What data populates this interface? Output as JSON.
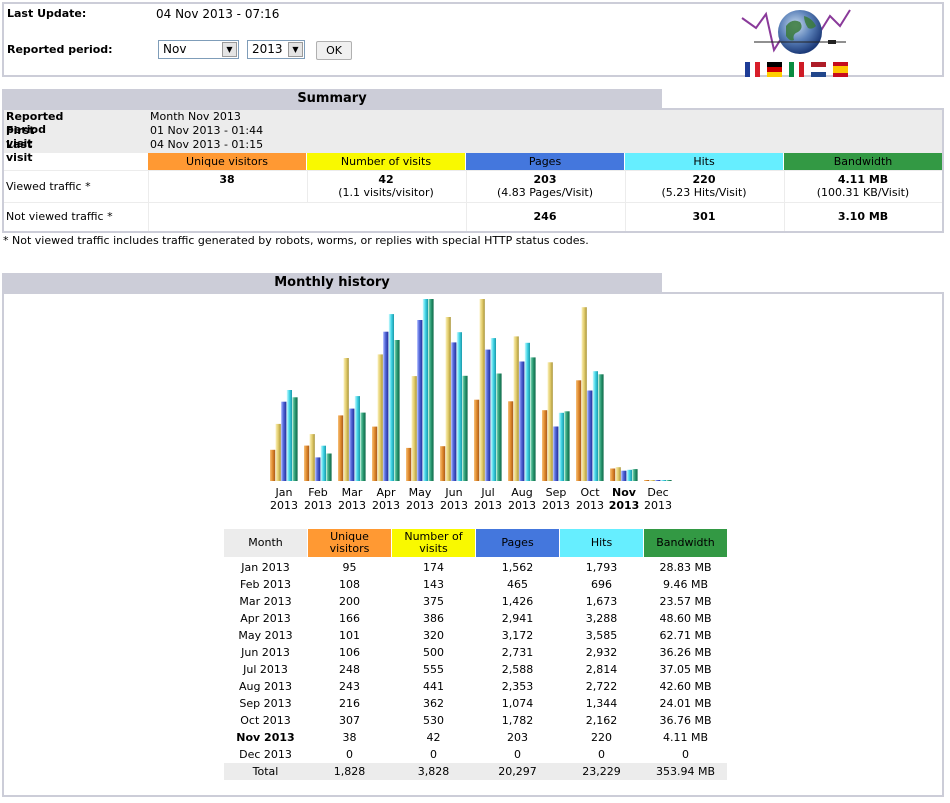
{
  "header": {
    "last_update_label": "Last Update:",
    "last_update_value": "04 Nov 2013 - 07:16",
    "reported_period_label": "Reported period:",
    "month_select_value": "Nov",
    "year_select_value": "2013",
    "ok_label": "OK",
    "languages": [
      "French",
      "German",
      "Italian",
      "Dutch",
      "Spanish"
    ]
  },
  "summary": {
    "title": "Summary",
    "reported_period_label": "Reported period",
    "reported_period_value": "Month Nov 2013",
    "first_visit_label": "First visit",
    "first_visit_value": "01 Nov 2013 - 01:44",
    "last_visit_label": "Last visit",
    "last_visit_value": "04 Nov 2013 - 01:15",
    "columns": [
      "Unique visitors",
      "Number of visits",
      "Pages",
      "Hits",
      "Bandwidth"
    ],
    "column_colors": [
      "#ff9933",
      "#f9f900",
      "#4477dd",
      "#66eeff",
      "#339944"
    ],
    "viewed_label": "Viewed traffic *",
    "viewed": {
      "unique": "38",
      "visits": "42",
      "visits_sub": "(1.1 visits/visitor)",
      "pages": "203",
      "pages_sub": "(4.83 Pages/Visit)",
      "hits": "220",
      "hits_sub": "(5.23 Hits/Visit)",
      "bandwidth": "4.11 MB",
      "bandwidth_sub": "(100.31 KB/Visit)"
    },
    "not_viewed_label": "Not viewed traffic *",
    "not_viewed": {
      "pages": "246",
      "hits": "301",
      "bandwidth": "3.10 MB"
    },
    "footnote": "* Not viewed traffic includes traffic generated by robots, worms, or replies with special HTTP status codes."
  },
  "monthly": {
    "title": "Monthly history",
    "table_headers": [
      "Month",
      "Unique visitors",
      "Number of visits",
      "Pages",
      "Hits",
      "Bandwidth"
    ],
    "rows": [
      [
        "Jan 2013",
        "95",
        "174",
        "1,562",
        "1,793",
        "28.83 MB"
      ],
      [
        "Feb 2013",
        "108",
        "143",
        "465",
        "696",
        "9.46 MB"
      ],
      [
        "Mar 2013",
        "200",
        "375",
        "1,426",
        "1,673",
        "23.57 MB"
      ],
      [
        "Apr 2013",
        "166",
        "386",
        "2,941",
        "3,288",
        "48.60 MB"
      ],
      [
        "May 2013",
        "101",
        "320",
        "3,172",
        "3,585",
        "62.71 MB"
      ],
      [
        "Jun 2013",
        "106",
        "500",
        "2,731",
        "2,932",
        "36.26 MB"
      ],
      [
        "Jul 2013",
        "248",
        "555",
        "2,588",
        "2,814",
        "37.05 MB"
      ],
      [
        "Aug 2013",
        "243",
        "441",
        "2,353",
        "2,722",
        "42.60 MB"
      ],
      [
        "Sep 2013",
        "216",
        "362",
        "1,074",
        "1,344",
        "24.01 MB"
      ],
      [
        "Oct 2013",
        "307",
        "530",
        "1,782",
        "2,162",
        "36.76 MB"
      ],
      [
        "Nov 2013",
        "38",
        "42",
        "203",
        "220",
        "4.11 MB"
      ],
      [
        "Dec 2013",
        "0",
        "0",
        "0",
        "0",
        "0"
      ]
    ],
    "current_row_index": 10,
    "total": [
      "Total",
      "1,828",
      "3,828",
      "20,297",
      "23,229",
      "353.94 MB"
    ]
  },
  "chart_data": {
    "type": "bar",
    "categories": [
      "Jan 2013",
      "Feb 2013",
      "Mar 2013",
      "Apr 2013",
      "May 2013",
      "Jun 2013",
      "Jul 2013",
      "Aug 2013",
      "Sep 2013",
      "Oct 2013",
      "Nov 2013",
      "Dec 2013"
    ],
    "category_labels": [
      [
        "Jan",
        "2013"
      ],
      [
        "Feb",
        "2013"
      ],
      [
        "Mar",
        "2013"
      ],
      [
        "Apr",
        "2013"
      ],
      [
        "May",
        "2013"
      ],
      [
        "Jun",
        "2013"
      ],
      [
        "Jul",
        "2013"
      ],
      [
        "Aug",
        "2013"
      ],
      [
        "Sep",
        "2013"
      ],
      [
        "Oct",
        "2013"
      ],
      [
        "Nov",
        "2013"
      ],
      [
        "Dec",
        "2013"
      ]
    ],
    "series": [
      {
        "name": "Unique visitors",
        "values": [
          95,
          108,
          200,
          166,
          101,
          106,
          248,
          243,
          216,
          307,
          38,
          0
        ]
      },
      {
        "name": "Number of visits",
        "values": [
          174,
          143,
          375,
          386,
          320,
          500,
          555,
          441,
          362,
          530,
          42,
          0
        ]
      },
      {
        "name": "Pages",
        "values": [
          1562,
          465,
          1426,
          2941,
          3172,
          2731,
          2588,
          2353,
          1074,
          1782,
          203,
          0
        ]
      },
      {
        "name": "Hits",
        "values": [
          1793,
          696,
          1673,
          3288,
          3585,
          2932,
          2814,
          2722,
          1344,
          2162,
          220,
          0
        ]
      },
      {
        "name": "Bandwidth (MB)",
        "values": [
          28.83,
          9.46,
          23.57,
          48.6,
          62.71,
          36.26,
          37.05,
          42.6,
          24.01,
          36.76,
          4.11,
          0
        ]
      }
    ],
    "series_colors": [
      "#e8963a",
      "#e6d070",
      "#4f63c8",
      "#48d8e8",
      "#2e9a72"
    ],
    "highlight_category": "Nov 2013",
    "grid": false,
    "legend": "none"
  }
}
